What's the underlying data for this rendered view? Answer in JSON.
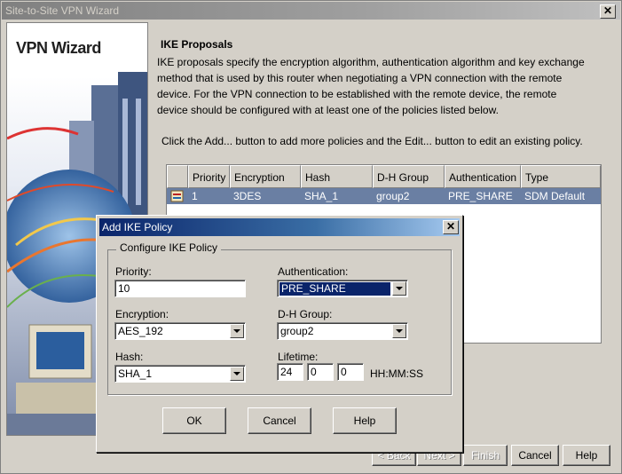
{
  "window": {
    "title": "Site-to-Site VPN Wizard",
    "close_glyph": "✕"
  },
  "sidebar": {
    "title": "VPN Wizard"
  },
  "content": {
    "heading": "IKE Proposals",
    "description_lines": [
      "IKE proposals specify the encryption algorithm, authentication algorithm and key exchange",
      "method that is used by this router when negotiating a VPN connection with the remote",
      "device. For the VPN connection to be established with the remote device, the remote",
      "device should be configured with at least one of the policies listed below."
    ],
    "hint": "Click the Add... button to add more policies and the Edit... button to edit an existing policy."
  },
  "table": {
    "headers": [
      "Priority",
      "Encryption",
      "Hash",
      "D-H Group",
      "Authentication",
      "Type"
    ],
    "rows": [
      {
        "priority": "1",
        "encryption": "3DES",
        "hash": "SHA_1",
        "dh_group": "group2",
        "authentication": "PRE_SHARE",
        "type": "SDM Default"
      }
    ]
  },
  "wizard_buttons": {
    "back": "< Back",
    "next": "Next >",
    "finish": "Finish",
    "cancel": "Cancel",
    "help": "Help"
  },
  "dialog": {
    "title": "Add IKE Policy",
    "group_label": "Configure IKE Policy",
    "priority_label": "Priority:",
    "priority_value": "10",
    "encryption_label": "Encryption:",
    "encryption_value": "AES_192",
    "hash_label": "Hash:",
    "hash_value": "SHA_1",
    "authentication_label": "Authentication:",
    "authentication_value": "PRE_SHARE",
    "dh_label": "D-H Group:",
    "dh_value": "group2",
    "lifetime_label": "Lifetime:",
    "lifetime_hh": "24",
    "lifetime_mm": "0",
    "lifetime_ss": "0",
    "lifetime_format": "HH:MM:SS",
    "ok": "OK",
    "cancel": "Cancel",
    "help": "Help"
  },
  "colors": {
    "selection": "#0a246a",
    "row_highlight": "#6a7fa3",
    "title_active": "#0a246a"
  }
}
